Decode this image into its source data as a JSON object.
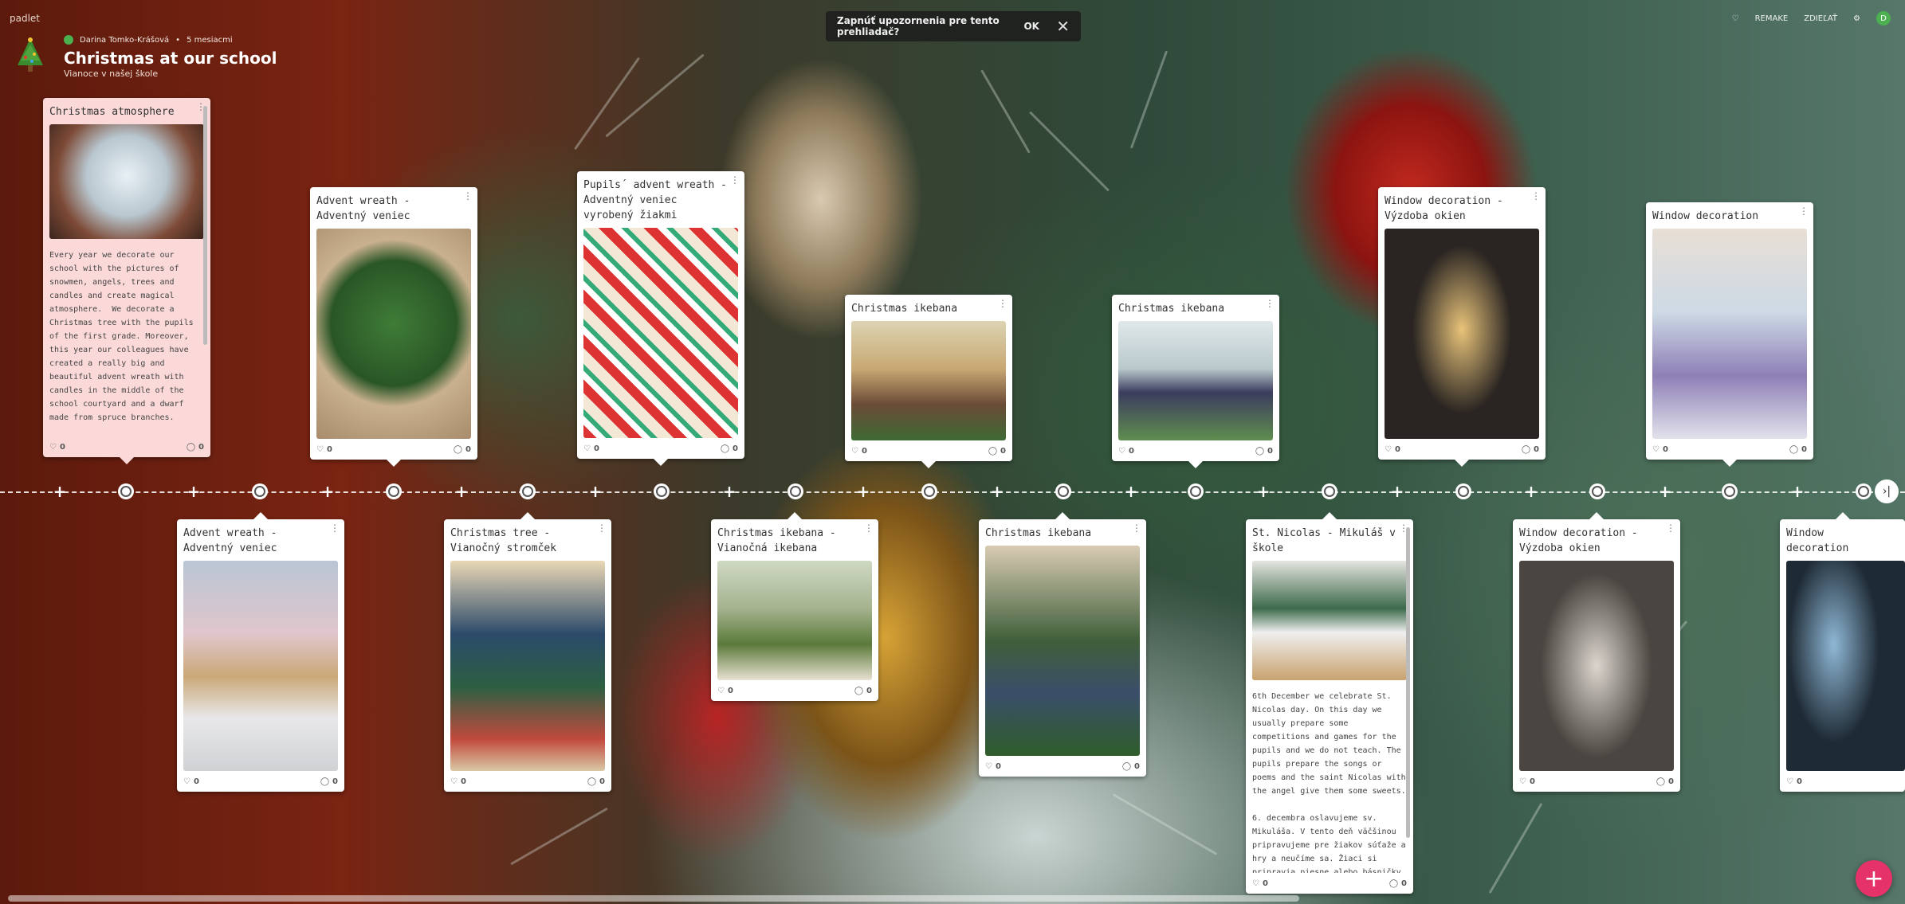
{
  "app": {
    "logo": "padlet"
  },
  "board": {
    "author": "Darina Tomko-Krášová",
    "separator": "•",
    "age": "5 mesiacmi",
    "title": "Christmas at our school",
    "subtitle": "Vianoce v našej škole"
  },
  "notification": {
    "message": "Zapnúť upozornenia pre tento prehliadač?",
    "ok_label": "OK",
    "close_glyph": "✕"
  },
  "toolbar": {
    "heart": "♡",
    "remake": "REMAKE",
    "share": "ZDIEĽAŤ",
    "settings": "⚙",
    "avatar": "D"
  },
  "timeline": {
    "next_glyph": "›|",
    "plus": "+"
  },
  "fab": {
    "label": "+"
  },
  "icons": {
    "like": "♡",
    "comment": "◯",
    "more": "⋮"
  },
  "cards": [
    {
      "title": "Christmas atmosphere",
      "body": "Every year we decorate our school with the pictures of snowmen, angels, trees and candles and create magical atmosphere.  We decorate a Christmas tree with the pupils of the first grade. Moreover, this year our colleagues have created a really big and beautiful advent wreath with candles in the middle of the school courtyard and a dwarf made from spruce branches.\n\nKaždý rok zdobíme školu obrázkami",
      "likes": "0",
      "comments": "0"
    },
    {
      "title": "Advent wreath - Adventný veniec",
      "likes": "0",
      "comments": "0"
    },
    {
      "title": "Pupils´ advent wreath - Adventný veniec vyrobený žiakmi",
      "likes": "0",
      "comments": "0"
    },
    {
      "title": "Christmas ikebana",
      "likes": "0",
      "comments": "0"
    },
    {
      "title": "Christmas ikebana",
      "likes": "0",
      "comments": "0"
    },
    {
      "title": "Window decoration - Výzdoba okien",
      "likes": "0",
      "comments": "0"
    },
    {
      "title": "Window decoration",
      "likes": "0",
      "comments": "0"
    },
    {
      "title": "Advent wreath - Adventný veniec",
      "likes": "0",
      "comments": "0"
    },
    {
      "title": "Christmas tree - Vianočný stromček",
      "likes": "0",
      "comments": "0"
    },
    {
      "title": "Christmas ikebana - Vianočná ikebana",
      "likes": "0",
      "comments": "0"
    },
    {
      "title": "Christmas ikebana",
      "likes": "0",
      "comments": "0"
    },
    {
      "title": "St. Nicolas - Mikuláš v škole",
      "body": "6th December we celebrate St. Nicolas day. On this day we usually prepare some competitions and games for the pupils and we do not teach. The pupils prepare the songs or poems and the saint Nicolas with the angel give them some sweets.\n\n6. decembra oslavujeme sv. Mikuláša. V tento deň väčšinou pripravujeme pre žiakov súťaže a hry a neučíme sa. Žiaci si pripravia piesne alebo básničky a Mikuláš s",
      "likes": "0",
      "comments": "0"
    },
    {
      "title": "Window decoration - Výzdoba okien",
      "likes": "0",
      "comments": "0"
    },
    {
      "title": "Window decoration",
      "likes": "0",
      "comments": "0"
    }
  ]
}
